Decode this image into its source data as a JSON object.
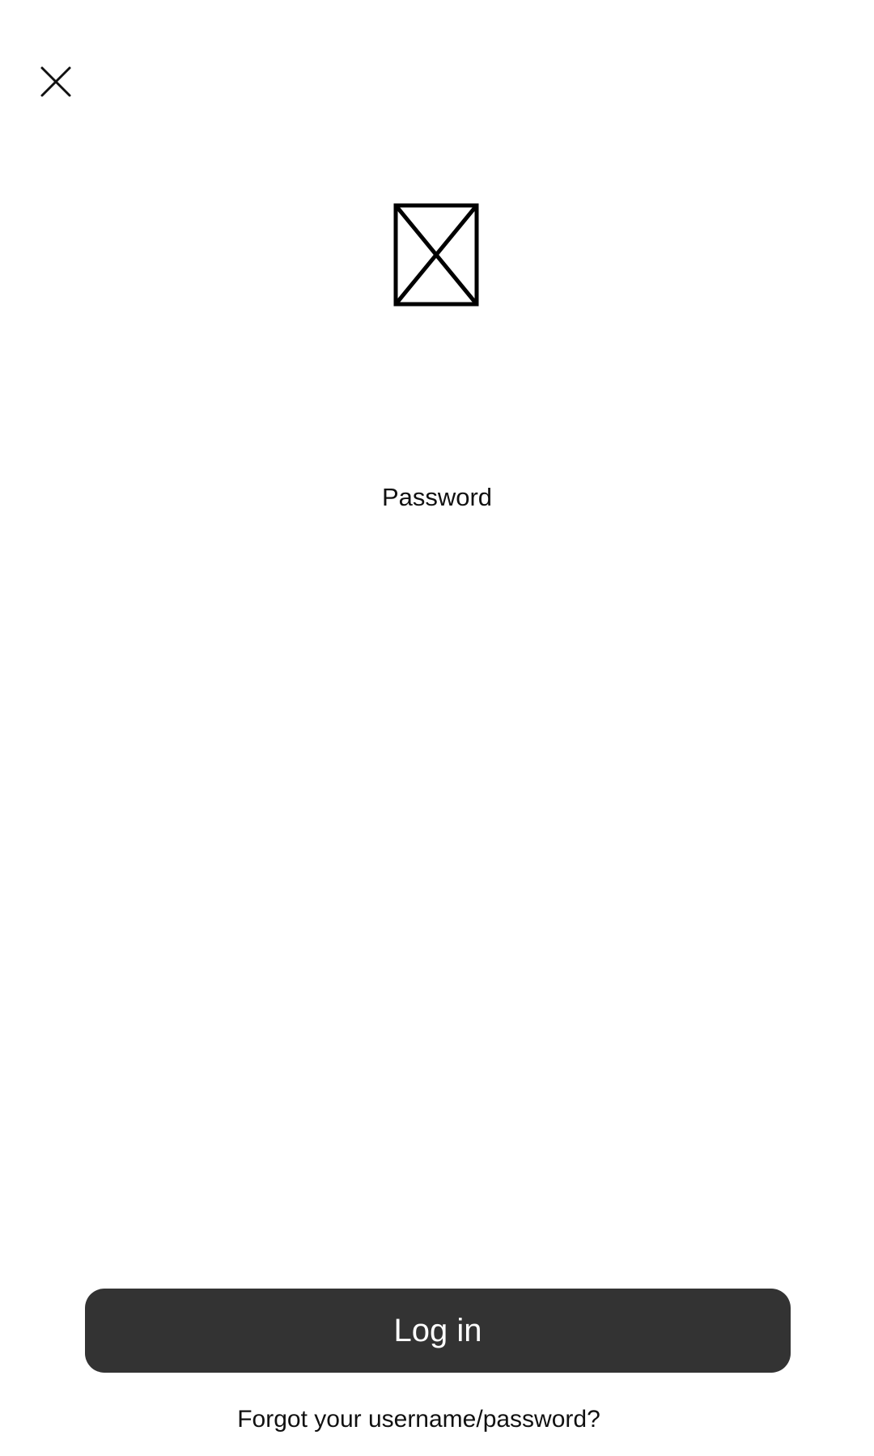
{
  "header": {
    "close_icon": "close-icon"
  },
  "logo": {
    "icon": "image-placeholder-icon"
  },
  "form": {
    "password_label": "Password"
  },
  "actions": {
    "login_label": "Log in",
    "forgot_label": "Forgot your username/password?"
  },
  "colors": {
    "background": "#ffffff",
    "button_background": "#333333",
    "button_text": "#ffffff",
    "text": "#111111"
  }
}
